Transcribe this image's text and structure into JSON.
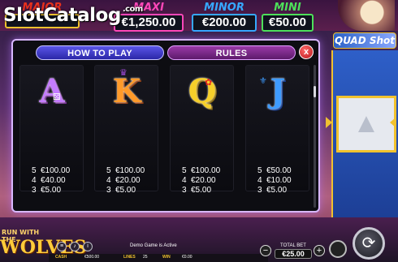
{
  "watermark": {
    "text": "SlotCatalog",
    "suffix": ".com"
  },
  "jackpots": {
    "major": {
      "label": "MAJOR",
      "value": ""
    },
    "maxi": {
      "label": "MAXI",
      "value": "€1,250.00"
    },
    "minor": {
      "label": "MINOR",
      "value": "€200.00"
    },
    "mini": {
      "label": "MINI",
      "value": "€50.00"
    }
  },
  "right_logo": "QUAD Shot",
  "paytable": {
    "tabs": {
      "how_to_play": "HOW TO PLAY",
      "rules": "RULES"
    },
    "close_label": "x",
    "symbols": [
      {
        "glyph": "A",
        "name": "ace",
        "pays": [
          {
            "count": "5",
            "amount": "€100.00"
          },
          {
            "count": "4",
            "amount": "€40.00"
          },
          {
            "count": "3",
            "amount": "€5.00"
          }
        ]
      },
      {
        "glyph": "K",
        "name": "king",
        "pays": [
          {
            "count": "5",
            "amount": "€100.00"
          },
          {
            "count": "4",
            "amount": "€20.00"
          },
          {
            "count": "3",
            "amount": "€5.00"
          }
        ]
      },
      {
        "glyph": "Q",
        "name": "queen",
        "pays": [
          {
            "count": "5",
            "amount": "€100.00"
          },
          {
            "count": "4",
            "amount": "€20.00"
          },
          {
            "count": "3",
            "amount": "€5.00"
          }
        ]
      },
      {
        "glyph": "J",
        "name": "jack",
        "pays": [
          {
            "count": "5",
            "amount": "€50.00"
          },
          {
            "count": "4",
            "amount": "€10.00"
          },
          {
            "count": "3",
            "amount": "€5.00"
          }
        ]
      }
    ]
  },
  "bottom": {
    "game_logo_small": "RUN WITH THE",
    "game_logo_big": "WOLVES",
    "demo_message": "Demo Game is Active",
    "cash_label": "CASH",
    "cash_value": "€500.00",
    "lines_label": "LINES",
    "lines_value": "25",
    "win_label": "WIN",
    "win_value": "€0.00",
    "total_bet_label": "TOTAL BET",
    "total_bet_value": "€25.00",
    "minus": "−",
    "plus": "+"
  },
  "colors": {
    "major": "#e8301c",
    "maxi": "#ff47b8",
    "minor": "#36a8ff",
    "mini": "#4de05a",
    "gold": "#f1c22e",
    "how_tab": "#3f3bd0",
    "rules_tab": "#7d2a8c"
  }
}
